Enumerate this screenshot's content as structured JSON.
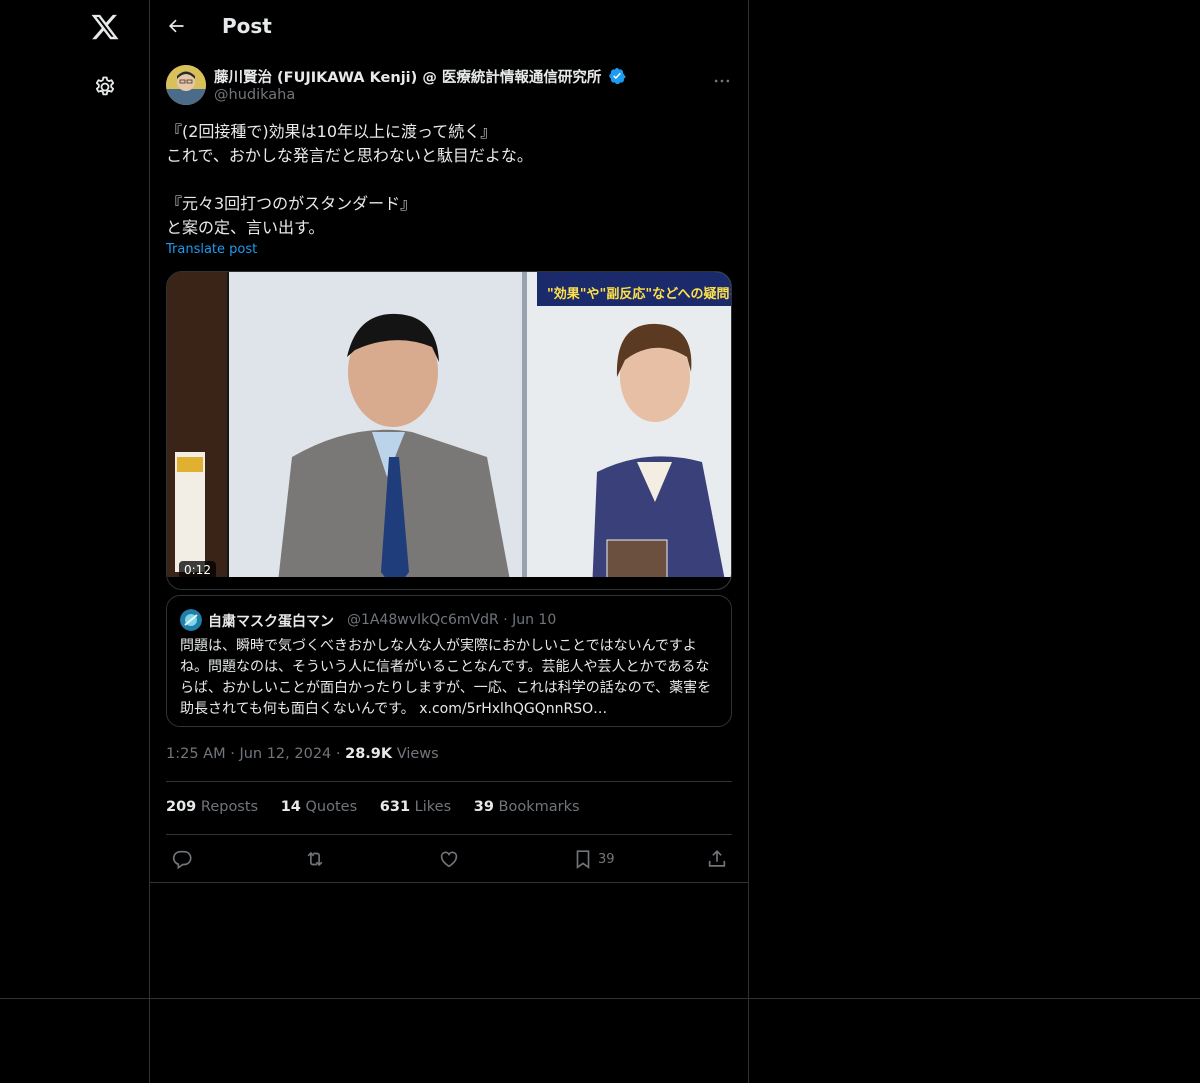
{
  "header": {
    "title": "Post"
  },
  "author": {
    "name": "藤川賢治 (FUJIKAWA Kenji) @ 医療統計情報通信研究所",
    "handle": "@hudikaha"
  },
  "tweet": {
    "lines": [
      "『(2回接種で)効果は10年以上に渡って続く』",
      "これで、おかしな発言だと思わないと駄目だよな。",
      "",
      "『元々3回打つのがスタンダード』",
      "と案の定、言い出す。"
    ],
    "translate_label": "Translate post"
  },
  "media": {
    "duration": "0:12",
    "caption_overlay": "\"効果\"や\"副反応\"などへの疑問を医師"
  },
  "quote": {
    "name": "自粛マスク蛋白マン",
    "handle": "@1A48wvIkQc6mVdR",
    "date": "Jun 10",
    "text": "問題は、瞬時で気づくべきおかしな人な人が実際におかしいことではないんですよね。問題なのは、そういう人に信者がいることなんです。芸能人や芸人とかであるならば、おかしいことが面白かったりしますが、一応、これは科学の話なので、薬害を助長されても何も面白くないんです。 x.com/5rHxlhQGQnnRSO…"
  },
  "meta": {
    "time": "1:25 AM",
    "date": "Jun 12, 2024",
    "views_count": "28.9K",
    "views_label": "Views"
  },
  "stats": {
    "reposts_count": "209",
    "reposts_label": "Reposts",
    "quotes_count": "14",
    "quotes_label": "Quotes",
    "likes_count": "631",
    "likes_label": "Likes",
    "bookmarks_count": "39",
    "bookmarks_label": "Bookmarks"
  },
  "actions": {
    "bookmark_count": "39"
  },
  "colors": {
    "accent": "#1d9bf0",
    "muted": "#71767b",
    "border": "#2f3336",
    "background": "#000000"
  },
  "icons": [
    "x-logo-icon",
    "gear-icon",
    "back-arrow-icon",
    "verified-badge-icon",
    "more-icon",
    "reply-icon",
    "repost-icon",
    "like-icon",
    "bookmark-icon",
    "share-icon"
  ]
}
